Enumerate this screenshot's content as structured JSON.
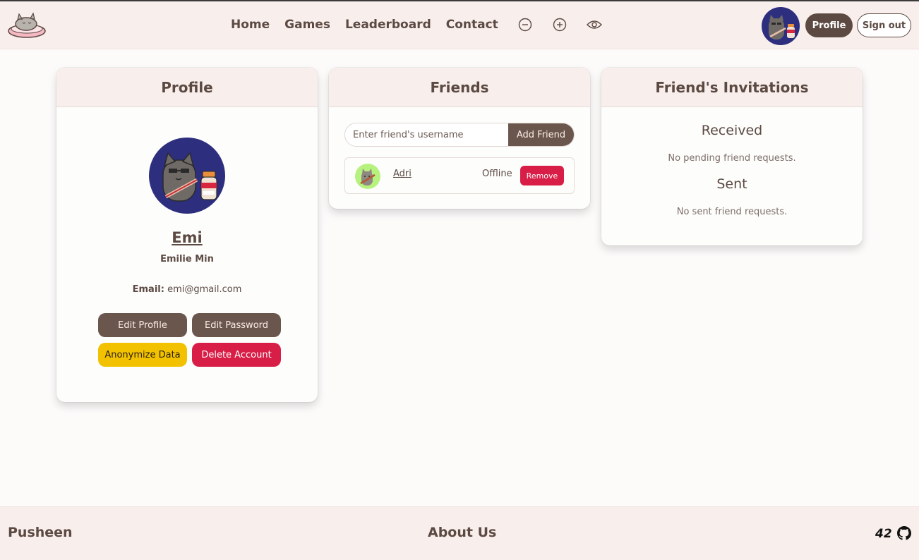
{
  "navbar": {
    "links": [
      "Home",
      "Games",
      "Leaderboard",
      "Contact"
    ],
    "icons": [
      "zoom-out-icon",
      "zoom-in-icon",
      "eye-icon"
    ],
    "profile_label": "Profile",
    "signout_label": "Sign out"
  },
  "profile_card": {
    "title": "Profile",
    "username": "Emi",
    "full_name": "Emilie Min",
    "email_label": "Email:",
    "email": "emi@gmail.com",
    "buttons": {
      "edit_profile": "Edit Profile",
      "edit_password": "Edit Password",
      "anonymize": "Anonymize Data",
      "delete": "Delete Account"
    }
  },
  "friends_card": {
    "title": "Friends",
    "input_placeholder": "Enter friend's username",
    "add_label": "Add Friend",
    "friends": [
      {
        "name": "Adri",
        "status": "Offline",
        "remove_label": "Remove"
      }
    ]
  },
  "invitations_card": {
    "title": "Friend's Invitations",
    "received_title": "Received",
    "received_text": "No pending friend requests.",
    "sent_title": "Sent",
    "sent_text": "No sent friend requests."
  },
  "footer": {
    "brand": "Pusheen",
    "about": "About Us",
    "school_label": "42"
  },
  "colors": {
    "brown": "#5c4a42",
    "button_brown": "#6b564d",
    "danger": "#d81e46",
    "warning": "#f2c200",
    "header_bg": "#f8eeec",
    "avatar_bg": "#2d2f7e"
  }
}
